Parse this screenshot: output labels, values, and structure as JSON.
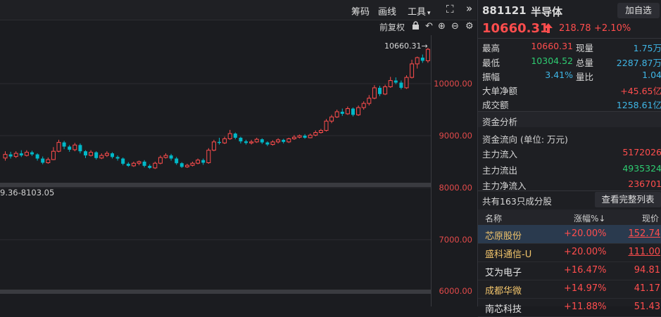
{
  "toolbar": {
    "chip": "筹码",
    "draw": "画线",
    "tools": "工具",
    "fuquan": "前复权"
  },
  "chart": {
    "high_label": "10660.31",
    "range_label": "9.36-8103.05",
    "y_ticks": [
      "10000.00",
      "9000.00",
      "8000.00",
      "7000.00",
      "6000.00"
    ]
  },
  "quote": {
    "code": "881121",
    "name": "半导体",
    "add_label": "加自选",
    "price": "10660.31",
    "change": "218.78",
    "change_pct": "+2.10%",
    "stats": [
      {
        "label": "最高",
        "value": "10660.31",
        "label2": "现量",
        "value2": "1.75万"
      },
      {
        "label": "最低",
        "value": "10304.52",
        "label2": "总量",
        "value2": "2287.87万"
      },
      {
        "label": "振幅",
        "value": "3.41%",
        "label2": "量比",
        "value2": "1.04"
      }
    ],
    "big_net_label": "大单净额",
    "big_net_value": "+45.65亿",
    "turnover_label": "成交额",
    "turnover_value": "1258.61亿"
  },
  "fund": {
    "title": "资金分析",
    "unit": "资金流向 (单位: 万元)",
    "inflow_label": "主力流入",
    "inflow_value": "5172026",
    "outflow_label": "主力流出",
    "outflow_value": "4935324",
    "net_label": "主力净流入",
    "net_value": "236701"
  },
  "stocks": {
    "title": "共有163只成分股",
    "full_btn": "查看完整列表",
    "headers": [
      "名称",
      "涨幅%↓",
      "现价"
    ],
    "rows": [
      {
        "name": "芯原股份",
        "pct": "+20.00%",
        "price": "152.74"
      },
      {
        "name": "盛科通信-U",
        "pct": "+20.00%",
        "price": "111.00"
      },
      {
        "name": "艾为电子",
        "pct": "+16.47%",
        "price": "94.81"
      },
      {
        "name": "成都华微",
        "pct": "+14.97%",
        "price": "41.17"
      },
      {
        "name": "南芯科技",
        "pct": "+11.88%",
        "price": "51.43"
      }
    ]
  },
  "candles": [
    {
      "o": 8570,
      "c": 8640,
      "h": 8700,
      "l": 8520
    },
    {
      "o": 8640,
      "c": 8600,
      "h": 8690,
      "l": 8560
    },
    {
      "o": 8600,
      "c": 8660,
      "h": 8700,
      "l": 8570
    },
    {
      "o": 8660,
      "c": 8620,
      "h": 8720,
      "l": 8590
    },
    {
      "o": 8620,
      "c": 8680,
      "h": 8720,
      "l": 8600
    },
    {
      "o": 8680,
      "c": 8640,
      "h": 8710,
      "l": 8610
    },
    {
      "o": 8640,
      "c": 8560,
      "h": 8660,
      "l": 8520
    },
    {
      "o": 8560,
      "c": 8480,
      "h": 8600,
      "l": 8450
    },
    {
      "o": 8480,
      "c": 8540,
      "h": 8580,
      "l": 8460
    },
    {
      "o": 8540,
      "c": 8700,
      "h": 8780,
      "l": 8530
    },
    {
      "o": 8700,
      "c": 8870,
      "h": 8920,
      "l": 8680
    },
    {
      "o": 8870,
      "c": 8790,
      "h": 8900,
      "l": 8740
    },
    {
      "o": 8790,
      "c": 8730,
      "h": 8820,
      "l": 8690
    },
    {
      "o": 8730,
      "c": 8820,
      "h": 8860,
      "l": 8700
    },
    {
      "o": 8820,
      "c": 8700,
      "h": 8850,
      "l": 8660
    },
    {
      "o": 8700,
      "c": 8620,
      "h": 8720,
      "l": 8570
    },
    {
      "o": 8620,
      "c": 8680,
      "h": 8720,
      "l": 8600
    },
    {
      "o": 8680,
      "c": 8570,
      "h": 8700,
      "l": 8540
    },
    {
      "o": 8570,
      "c": 8620,
      "h": 8660,
      "l": 8550
    },
    {
      "o": 8620,
      "c": 8660,
      "h": 8700,
      "l": 8590
    },
    {
      "o": 8660,
      "c": 8590,
      "h": 8680,
      "l": 8560
    },
    {
      "o": 8590,
      "c": 8560,
      "h": 8620,
      "l": 8520
    },
    {
      "o": 8560,
      "c": 8460,
      "h": 8580,
      "l": 8430
    },
    {
      "o": 8460,
      "c": 8420,
      "h": 8490,
      "l": 8400
    },
    {
      "o": 8420,
      "c": 8470,
      "h": 8500,
      "l": 8400
    },
    {
      "o": 8470,
      "c": 8500,
      "h": 8520,
      "l": 8430
    },
    {
      "o": 8500,
      "c": 8420,
      "h": 8530,
      "l": 8390
    },
    {
      "o": 8420,
      "c": 8380,
      "h": 8450,
      "l": 8360
    },
    {
      "o": 8380,
      "c": 8470,
      "h": 8500,
      "l": 8360
    },
    {
      "o": 8470,
      "c": 8580,
      "h": 8620,
      "l": 8450
    },
    {
      "o": 8580,
      "c": 8620,
      "h": 8660,
      "l": 8560
    },
    {
      "o": 8620,
      "c": 8560,
      "h": 8650,
      "l": 8520
    },
    {
      "o": 8560,
      "c": 8470,
      "h": 8590,
      "l": 8440
    },
    {
      "o": 8470,
      "c": 8400,
      "h": 8490,
      "l": 8380
    },
    {
      "o": 8400,
      "c": 8430,
      "h": 8460,
      "l": 8380
    },
    {
      "o": 8430,
      "c": 8470,
      "h": 8500,
      "l": 8410
    },
    {
      "o": 8470,
      "c": 8530,
      "h": 8560,
      "l": 8450
    },
    {
      "o": 8530,
      "c": 8480,
      "h": 8560,
      "l": 8440
    },
    {
      "o": 8480,
      "c": 8720,
      "h": 8760,
      "l": 8460
    },
    {
      "o": 8720,
      "c": 8880,
      "h": 8920,
      "l": 8700
    },
    {
      "o": 8880,
      "c": 8860,
      "h": 8960,
      "l": 8830
    },
    {
      "o": 8860,
      "c": 8940,
      "h": 8980,
      "l": 8840
    },
    {
      "o": 8940,
      "c": 9040,
      "h": 9110,
      "l": 8920
    },
    {
      "o": 9040,
      "c": 8960,
      "h": 9060,
      "l": 8930
    },
    {
      "o": 8960,
      "c": 8890,
      "h": 8980,
      "l": 8850
    },
    {
      "o": 8890,
      "c": 8860,
      "h": 8920,
      "l": 8830
    },
    {
      "o": 8860,
      "c": 8880,
      "h": 8920,
      "l": 8830
    },
    {
      "o": 8880,
      "c": 8930,
      "h": 8960,
      "l": 8860
    },
    {
      "o": 8930,
      "c": 8870,
      "h": 8950,
      "l": 8840
    },
    {
      "o": 8870,
      "c": 8830,
      "h": 8890,
      "l": 8800
    },
    {
      "o": 8830,
      "c": 8880,
      "h": 8910,
      "l": 8810
    },
    {
      "o": 8880,
      "c": 8920,
      "h": 8950,
      "l": 8850
    },
    {
      "o": 8920,
      "c": 8880,
      "h": 8940,
      "l": 8850
    },
    {
      "o": 8880,
      "c": 8940,
      "h": 8960,
      "l": 8860
    },
    {
      "o": 8940,
      "c": 8970,
      "h": 9010,
      "l": 8920
    },
    {
      "o": 8970,
      "c": 9000,
      "h": 9020,
      "l": 8950
    },
    {
      "o": 9000,
      "c": 8960,
      "h": 9030,
      "l": 8940
    },
    {
      "o": 8960,
      "c": 9010,
      "h": 9040,
      "l": 8950
    },
    {
      "o": 9010,
      "c": 9060,
      "h": 9100,
      "l": 8990
    },
    {
      "o": 9060,
      "c": 9100,
      "h": 9130,
      "l": 9040
    },
    {
      "o": 9100,
      "c": 9280,
      "h": 9320,
      "l": 9080
    },
    {
      "o": 9280,
      "c": 9360,
      "h": 9400,
      "l": 9240
    },
    {
      "o": 9360,
      "c": 9460,
      "h": 9500,
      "l": 9340
    },
    {
      "o": 9460,
      "c": 9420,
      "h": 9520,
      "l": 9380
    },
    {
      "o": 9420,
      "c": 9520,
      "h": 9560,
      "l": 9400
    },
    {
      "o": 9520,
      "c": 9400,
      "h": 9540,
      "l": 9370
    },
    {
      "o": 9400,
      "c": 9540,
      "h": 9580,
      "l": 9380
    },
    {
      "o": 9540,
      "c": 9620,
      "h": 9660,
      "l": 9500
    },
    {
      "o": 9620,
      "c": 9720,
      "h": 9780,
      "l": 9580
    },
    {
      "o": 9720,
      "c": 9920,
      "h": 9970,
      "l": 9700
    },
    {
      "o": 9920,
      "c": 9800,
      "h": 9960,
      "l": 9760
    },
    {
      "o": 9800,
      "c": 9940,
      "h": 9980,
      "l": 9780
    },
    {
      "o": 9940,
      "c": 10060,
      "h": 10130,
      "l": 9920
    },
    {
      "o": 10060,
      "c": 10020,
      "h": 10120,
      "l": 9990
    },
    {
      "o": 10020,
      "c": 9920,
      "h": 10060,
      "l": 9890
    },
    {
      "o": 9920,
      "c": 10120,
      "h": 10160,
      "l": 9900
    },
    {
      "o": 10120,
      "c": 10380,
      "h": 10460,
      "l": 10100
    },
    {
      "o": 10380,
      "c": 10500,
      "h": 10520,
      "l": 10290
    },
    {
      "o": 10500,
      "c": 10440,
      "h": 10560,
      "l": 10400
    },
    {
      "o": 10440,
      "c": 10660,
      "h": 10690,
      "l": 10400
    }
  ]
}
